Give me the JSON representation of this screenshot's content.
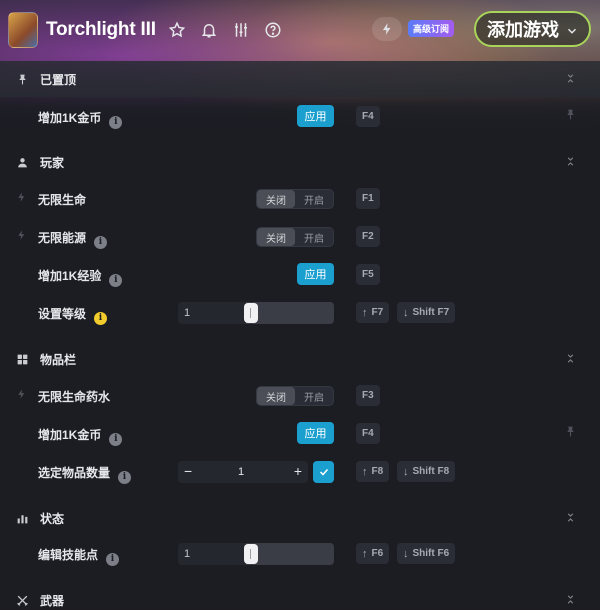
{
  "header": {
    "title": "Torchlight III",
    "pro_badge": "高级订阅",
    "add_game_label": "添加游戏"
  },
  "sections": {
    "pinned": {
      "title": "已置顶"
    },
    "player": {
      "title": "玩家"
    },
    "inventory": {
      "title": "物品栏"
    },
    "stats": {
      "title": "状态"
    },
    "weapons": {
      "title": "武器"
    }
  },
  "toggle_labels": {
    "off": "关闭",
    "on": "开启"
  },
  "apply_label": "应用",
  "rows": {
    "pinned_gold": {
      "label": "增加1K金币",
      "key": "F4"
    },
    "infinite_health": {
      "label": "无限生命",
      "key": "F1",
      "state": "关闭"
    },
    "infinite_energy": {
      "label": "无限能源",
      "key": "F2",
      "state": "关闭"
    },
    "add_exp": {
      "label": "增加1K经验",
      "key": "F5"
    },
    "set_level": {
      "label": "设置等级",
      "value": "1",
      "key_up": "F7",
      "key_down": "Shift F7"
    },
    "infinite_potions": {
      "label": "无限生命药水",
      "key": "F3",
      "state": "关闭"
    },
    "add_gold": {
      "label": "增加1K金币",
      "key": "F4"
    },
    "item_quantity": {
      "label": "选定物品数量",
      "value": "1",
      "key_up": "F8",
      "key_down": "Shift F8"
    },
    "skill_points": {
      "label": "编辑技能点",
      "value": "1",
      "key_up": "F6",
      "key_down": "Shift F6"
    }
  },
  "colors": {
    "accent": "#1b9fcf",
    "add_game_border": "#a8d45a",
    "info_highlight": "#f2cc2c",
    "background": "#1b1d23"
  }
}
